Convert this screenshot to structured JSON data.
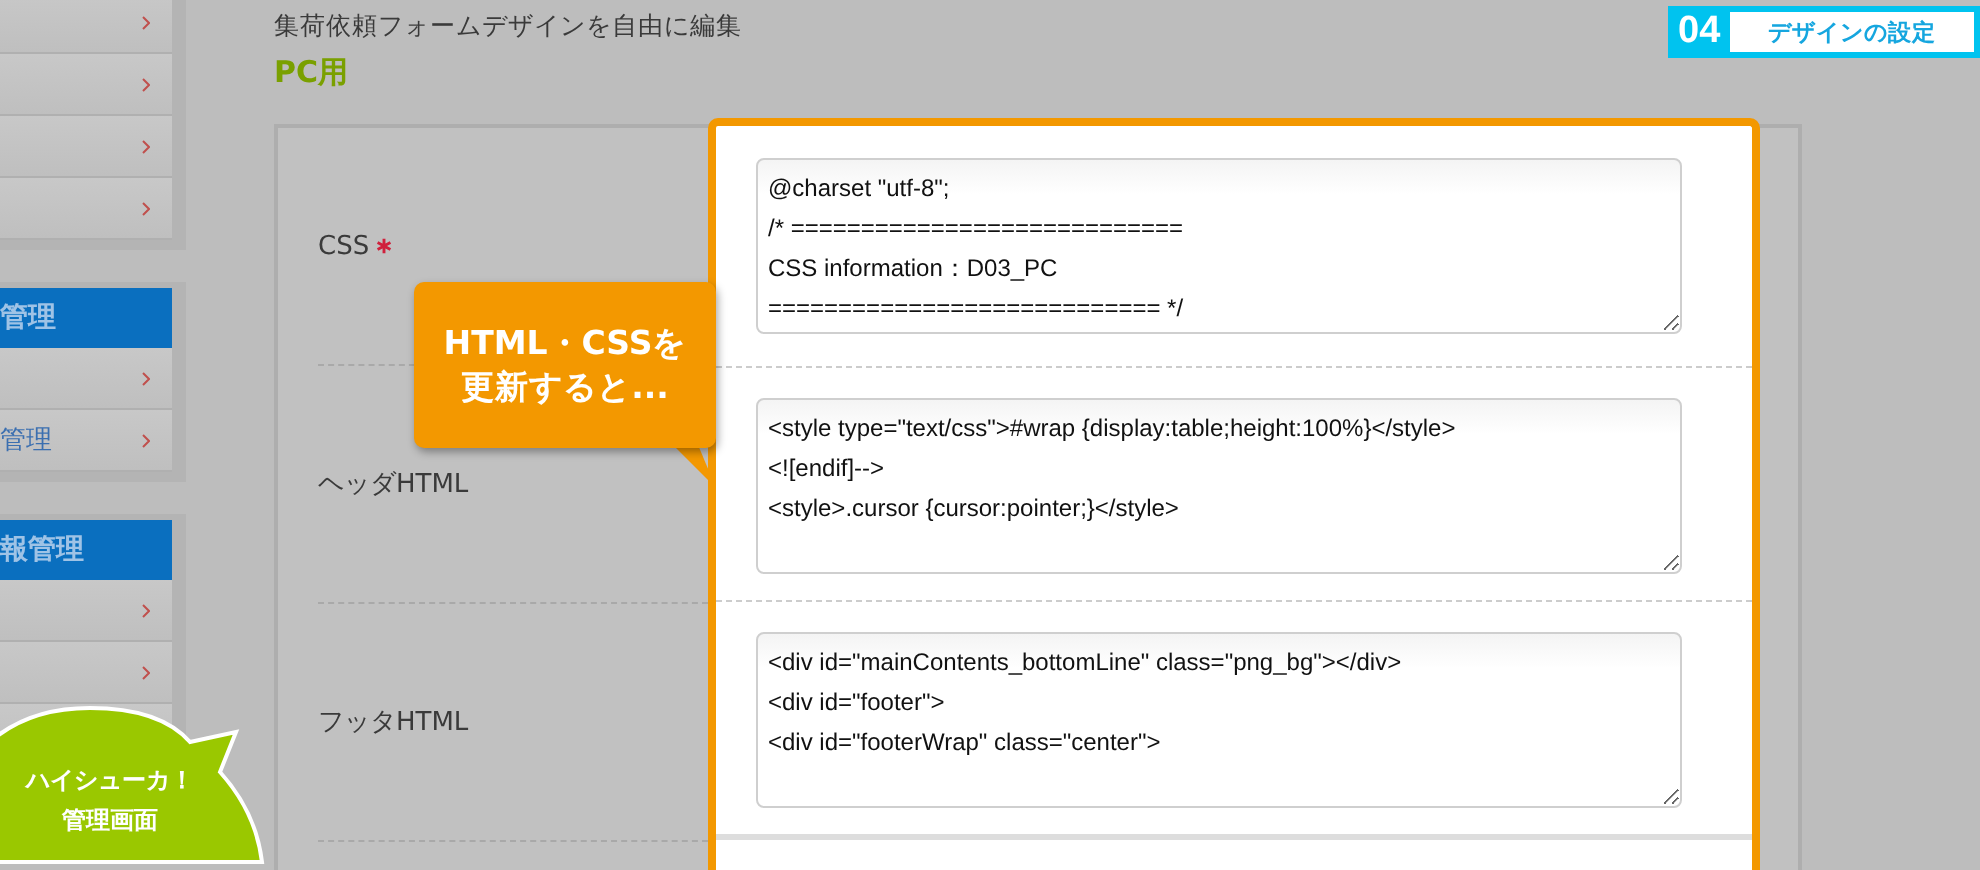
{
  "sidebar": {
    "groups": [
      {
        "items": [
          {
            "kind": "link"
          },
          {
            "kind": "link"
          },
          {
            "kind": "link"
          },
          {
            "kind": "link"
          }
        ]
      },
      {
        "heading": "管理",
        "items": [
          {
            "kind": "link"
          },
          {
            "kind": "link",
            "label": "管理"
          }
        ]
      },
      {
        "heading": "報管理",
        "items": [
          {
            "kind": "link"
          },
          {
            "kind": "link"
          },
          {
            "kind": "link"
          }
        ]
      }
    ]
  },
  "page": {
    "description": "集荷依頼フォームデザインを自由に編集",
    "section_title": "PC用"
  },
  "step_badge": {
    "number": "04",
    "label": "デザインの設定"
  },
  "form": {
    "rows": [
      {
        "label": "CSS",
        "required": true,
        "value": [
          "@charset \"utf-8\";",
          "/* ============================",
          "CSS information：D03_PC",
          "============================ */"
        ]
      },
      {
        "label": "ヘッダHTML",
        "required": false,
        "value": [
          "<style type=\"text/css\">#wrap {display:table;height:100%}</style>",
          "<![endif]-->",
          "<style>.cursor {cursor:pointer;}</style>"
        ]
      },
      {
        "label": "フッタHTML",
        "required": false,
        "value": [
          "<div id=\"mainContents_bottomLine\" class=\"png_bg\"></div>",
          "<div id=\"footer\">",
          "<div id=\"footerWrap\" class=\"center\">"
        ]
      }
    ]
  },
  "callout": {
    "lines": [
      "HTML・CSSを",
      "更新すると..."
    ]
  },
  "bubble": {
    "lines": [
      "ハイシューカ！",
      "管理画面"
    ]
  }
}
